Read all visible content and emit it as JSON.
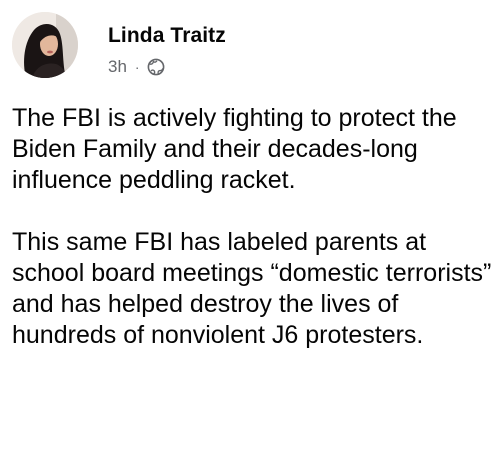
{
  "author": {
    "name": "Linda Traitz"
  },
  "post": {
    "timestamp": "3h",
    "separator": "·",
    "audience_icon": "globe-icon",
    "paragraphs": [
      "The FBI is actively fighting to protect the Biden Family and their decades-long influence peddling racket.",
      "This same FBI has labeled parents at school board meetings “domestic terrorists” and has helped destroy the lives of hundreds of nonviolent J6 protesters."
    ]
  },
  "colors": {
    "name_text": "#050505",
    "meta_text": "#65676b",
    "body_text": "#050505",
    "background": "#ffffff"
  }
}
